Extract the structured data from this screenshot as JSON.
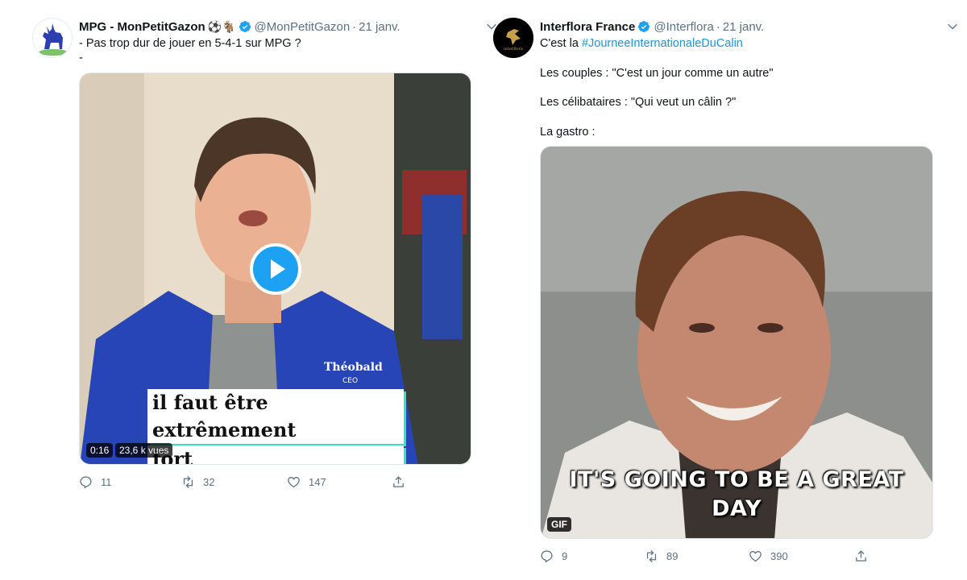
{
  "tweets": [
    {
      "name": "MPG - MonPetitGazon",
      "emojis": "⚽🐐",
      "handle": "@MonPetitGazon",
      "date": "21 janv.",
      "lines": [
        "- Pas trop dur de jouer en 5-4-1 sur MPG ?",
        "-"
      ],
      "media": {
        "type": "video",
        "duration": "0:16",
        "views": "23,6 k vues",
        "subtitle_lines": [
          "il faut être extrêmement",
          "fort psychologiquement"
        ],
        "sign_name": "Théobald",
        "sign_title": "CEO"
      },
      "actions": {
        "replies": "11",
        "retweets": "32",
        "likes": "147"
      }
    },
    {
      "name": "Interflora France",
      "handle": "@Interflora",
      "date": "21 janv.",
      "line1_prefix": "C'est la ",
      "hashtag": "#JourneeInternationaleDuCalin",
      "lines": [
        "Les couples : \"C'est un jour comme un autre\"",
        "Les célibataires : \"Qui veut un câlin ?\"",
        "La gastro :"
      ],
      "media": {
        "type": "gif",
        "caption_line1": "IT'S GOING TO BE A GREAT",
        "caption_line2": "DAY",
        "badge": "GIF"
      },
      "actions": {
        "replies": "9",
        "retweets": "89",
        "likes": "390"
      }
    }
  ],
  "icons": {
    "reply": "reply-icon",
    "retweet": "retweet-icon",
    "like": "heart-icon",
    "share": "share-icon",
    "verified": "verified-badge-icon",
    "caret": "chevron-down-icon",
    "play": "play-icon"
  },
  "colors": {
    "verified": "#1da1f2",
    "hashtag": "#1b95e0",
    "secondary_text": "#5b7083",
    "play_button": "#1da1f2"
  }
}
